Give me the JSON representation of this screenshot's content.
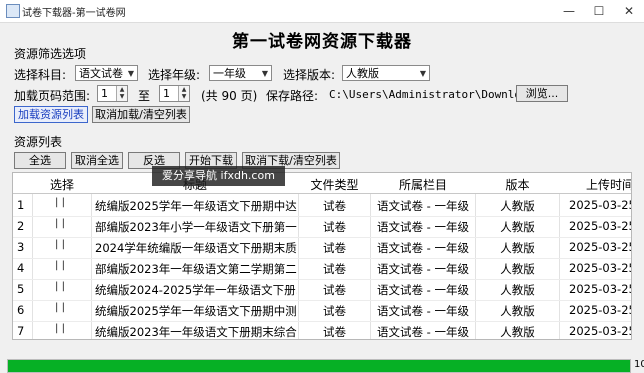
{
  "window": {
    "title": "试卷下载器-第一试卷网"
  },
  "heading": "第一试卷网资源下载器",
  "filters": {
    "section_title": "资源筛选选项",
    "subject_label": "选择科目:",
    "subject_value": "语文试卷",
    "grade_label": "选择年级:",
    "grade_value": "一年级",
    "version_label": "选择版本:",
    "version_value": "人教版",
    "page_range_label": "加载页码范围:",
    "page_from": "1",
    "to_label": "至",
    "page_to": "1",
    "total_pages": "(共 90 页)",
    "save_path_label": "保存路径:",
    "save_path": "C:\\Users\\Administrator\\Downloads",
    "browse_button": "浏览...",
    "load_button": "加载资源列表",
    "cancel_load_button": "取消加载/清空列表"
  },
  "resource_list": {
    "section_title": "资源列表",
    "select_all": "全选",
    "deselect_all": "取消全选",
    "invert": "反选",
    "start_download": "开始下载",
    "cancel_download": "取消下载/清空列表",
    "columns": [
      "选择",
      "标题",
      "文件类型",
      "所属栏目",
      "版本",
      "上传时间"
    ],
    "rows": [
      {
        "num": "1",
        "check": "| |",
        "title": "统编版2025学年一年级语文下册期中达…",
        "type": "试卷",
        "category": "语文试卷 - 一年级",
        "version": "人教版",
        "date": "2025-03-25"
      },
      {
        "num": "2",
        "check": "| |",
        "title": "部编版2023年小学一年级语文下册第一…",
        "type": "试卷",
        "category": "语文试卷 - 一年级",
        "version": "人教版",
        "date": "2025-03-25"
      },
      {
        "num": "3",
        "check": "| |",
        "title": "2024学年统编版一年级语文下册期末质…",
        "type": "试卷",
        "category": "语文试卷 - 一年级",
        "version": "人教版",
        "date": "2025-03-25"
      },
      {
        "num": "4",
        "check": "| |",
        "title": "部编版2023年一年级语文第二学期第二…",
        "type": "试卷",
        "category": "语文试卷 - 一年级",
        "version": "人教版",
        "date": "2025-03-25"
      },
      {
        "num": "5",
        "check": "| |",
        "title": "统编版2024-2025学年一年级语文下册…",
        "type": "试卷",
        "category": "语文试卷 - 一年级",
        "version": "人教版",
        "date": "2025-03-25"
      },
      {
        "num": "6",
        "check": "| |",
        "title": "统编版2025学年一年级语文下册期中测…",
        "type": "试卷",
        "category": "语文试卷 - 一年级",
        "version": "人教版",
        "date": "2025-03-25"
      },
      {
        "num": "7",
        "check": "| |",
        "title": "统编版2023年一年级语文下册期末综合…",
        "type": "试卷",
        "category": "语文试卷 - 一年级",
        "version": "人教版",
        "date": "2025-03-25"
      }
    ]
  },
  "overlay_text": "爱分享导航 ifxdh.com",
  "progress": {
    "value_percent": 100,
    "label": "10",
    "color": "#06b025"
  },
  "colors": {
    "link_blue": "#1a3fbf",
    "window_bg": "#f0f0f0"
  }
}
